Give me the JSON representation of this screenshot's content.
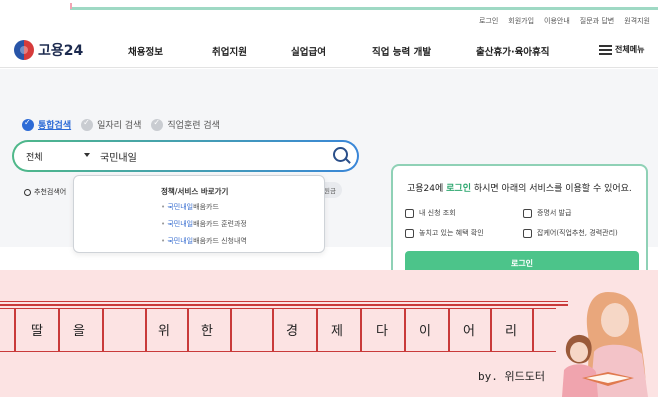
{
  "util_links": [
    "로그인",
    "회원가입",
    "이용안내",
    "질문과 답변",
    "원격지원"
  ],
  "header": {
    "logo_text": "고용24",
    "nav": [
      "채용정보",
      "취업지원",
      "실업급여",
      "직업 능력 개발",
      "출산휴가·육아휴직"
    ],
    "all_menu_label": "전체메뉴"
  },
  "search": {
    "tabs": [
      {
        "label": "통합검색",
        "active": true
      },
      {
        "label": "일자리 검색",
        "active": false
      },
      {
        "label": "직업훈련 검색",
        "active": false
      }
    ],
    "select_value": "전체",
    "query": "국민내일",
    "recommend_label": "추천검색어",
    "chip_label": "원금"
  },
  "dropdown": {
    "title": "정책/서비스 바로가기",
    "items": [
      {
        "hl": "국민내일",
        "rest": "배움카드"
      },
      {
        "hl": "국민내일",
        "rest": "배움카드 훈련과정"
      },
      {
        "hl": "국민내일",
        "rest": "배움카드 신청내역"
      }
    ]
  },
  "login_card": {
    "title_pre": "고용24에 ",
    "title_hl": "로그인",
    "title_post": " 하시면 아래의 서비스를 이용할 수 있어요.",
    "services": [
      "내 신청 조회",
      "증명서 발급",
      "놓치고 있는 혜택 확인",
      "잡케어(직업추천, 경력관리)"
    ],
    "button_label": "로그인"
  },
  "banner": {
    "glyphs": [
      "딸",
      "을",
      "위",
      "한",
      "경",
      "제",
      "다",
      "이",
      "어",
      "리"
    ],
    "signature": "by. 위드도터"
  },
  "colors": {
    "brand_green": "#4cc48a",
    "accent_blue": "#2d6bd6",
    "banner_pink": "#fce3e3",
    "banner_red": "#c93a3a"
  }
}
